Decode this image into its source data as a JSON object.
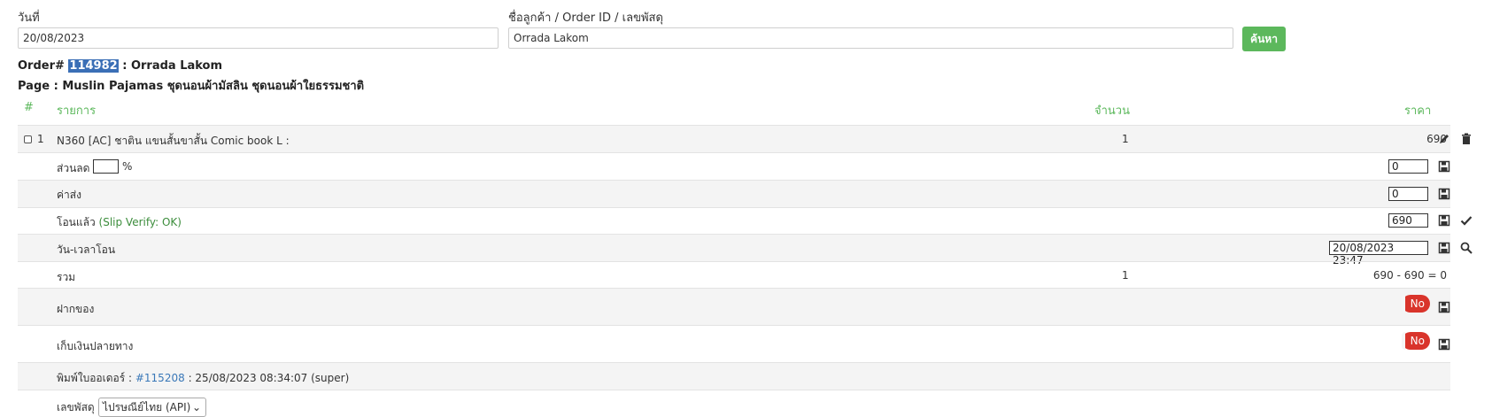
{
  "search": {
    "date_label": "วันที่",
    "date_value": "20/08/2023",
    "query_label": "ชื่อลูกค้า / Order ID / เลขพัสดุ",
    "query_value": "Orrada Lakom",
    "button": "ค้นหา"
  },
  "order": {
    "prefix": "Order#",
    "id": "114982",
    "customer": ": Orrada Lakom",
    "page_line": "Page : Muslin Pajamas ชุดนอนผ้ามัสลิน ชุดนอนผ้าใยธรรมชาติ"
  },
  "table": {
    "headers": {
      "index": "#",
      "item": "รายการ",
      "qty": "จำนวน",
      "price": "ราคา"
    },
    "item": {
      "index": "1",
      "name": "N360 [AC] ชาติน แขนสั้นขาสั้น Comic book L :",
      "qty": "1",
      "price": "690"
    },
    "discount": {
      "label": "ส่วนลด",
      "value": "",
      "unit": "%",
      "amount": "0"
    },
    "shipping": {
      "label": "ค่าส่ง",
      "amount": "0"
    },
    "paid": {
      "label": "โอนแล้ว",
      "status": "(Slip Verify: OK)",
      "amount": "690"
    },
    "transfer_time": {
      "label": "วัน-เวลาโอน",
      "value": "20/08/2023 23:47"
    },
    "total": {
      "label": "รวม",
      "qty": "1",
      "formula": "690 - 690 = 0"
    },
    "deposit": {
      "label": "ฝากของ",
      "toggle": "No"
    },
    "cod": {
      "label": "เก็บเงินปลายทาง",
      "toggle": "No"
    },
    "print": {
      "label": "พิมพ์ใบออเดอร์ :",
      "link": "#115208",
      "detail": ": 25/08/2023 08:34:07 (super)"
    },
    "tracking": {
      "label": "เลขพัสดุ",
      "carrier": "ไปรษณีย์ไทย (API)"
    }
  },
  "colors": {
    "accent_green": "#5cb85c",
    "toggle_red": "#d9342b",
    "highlight": "#3b6fb6"
  }
}
